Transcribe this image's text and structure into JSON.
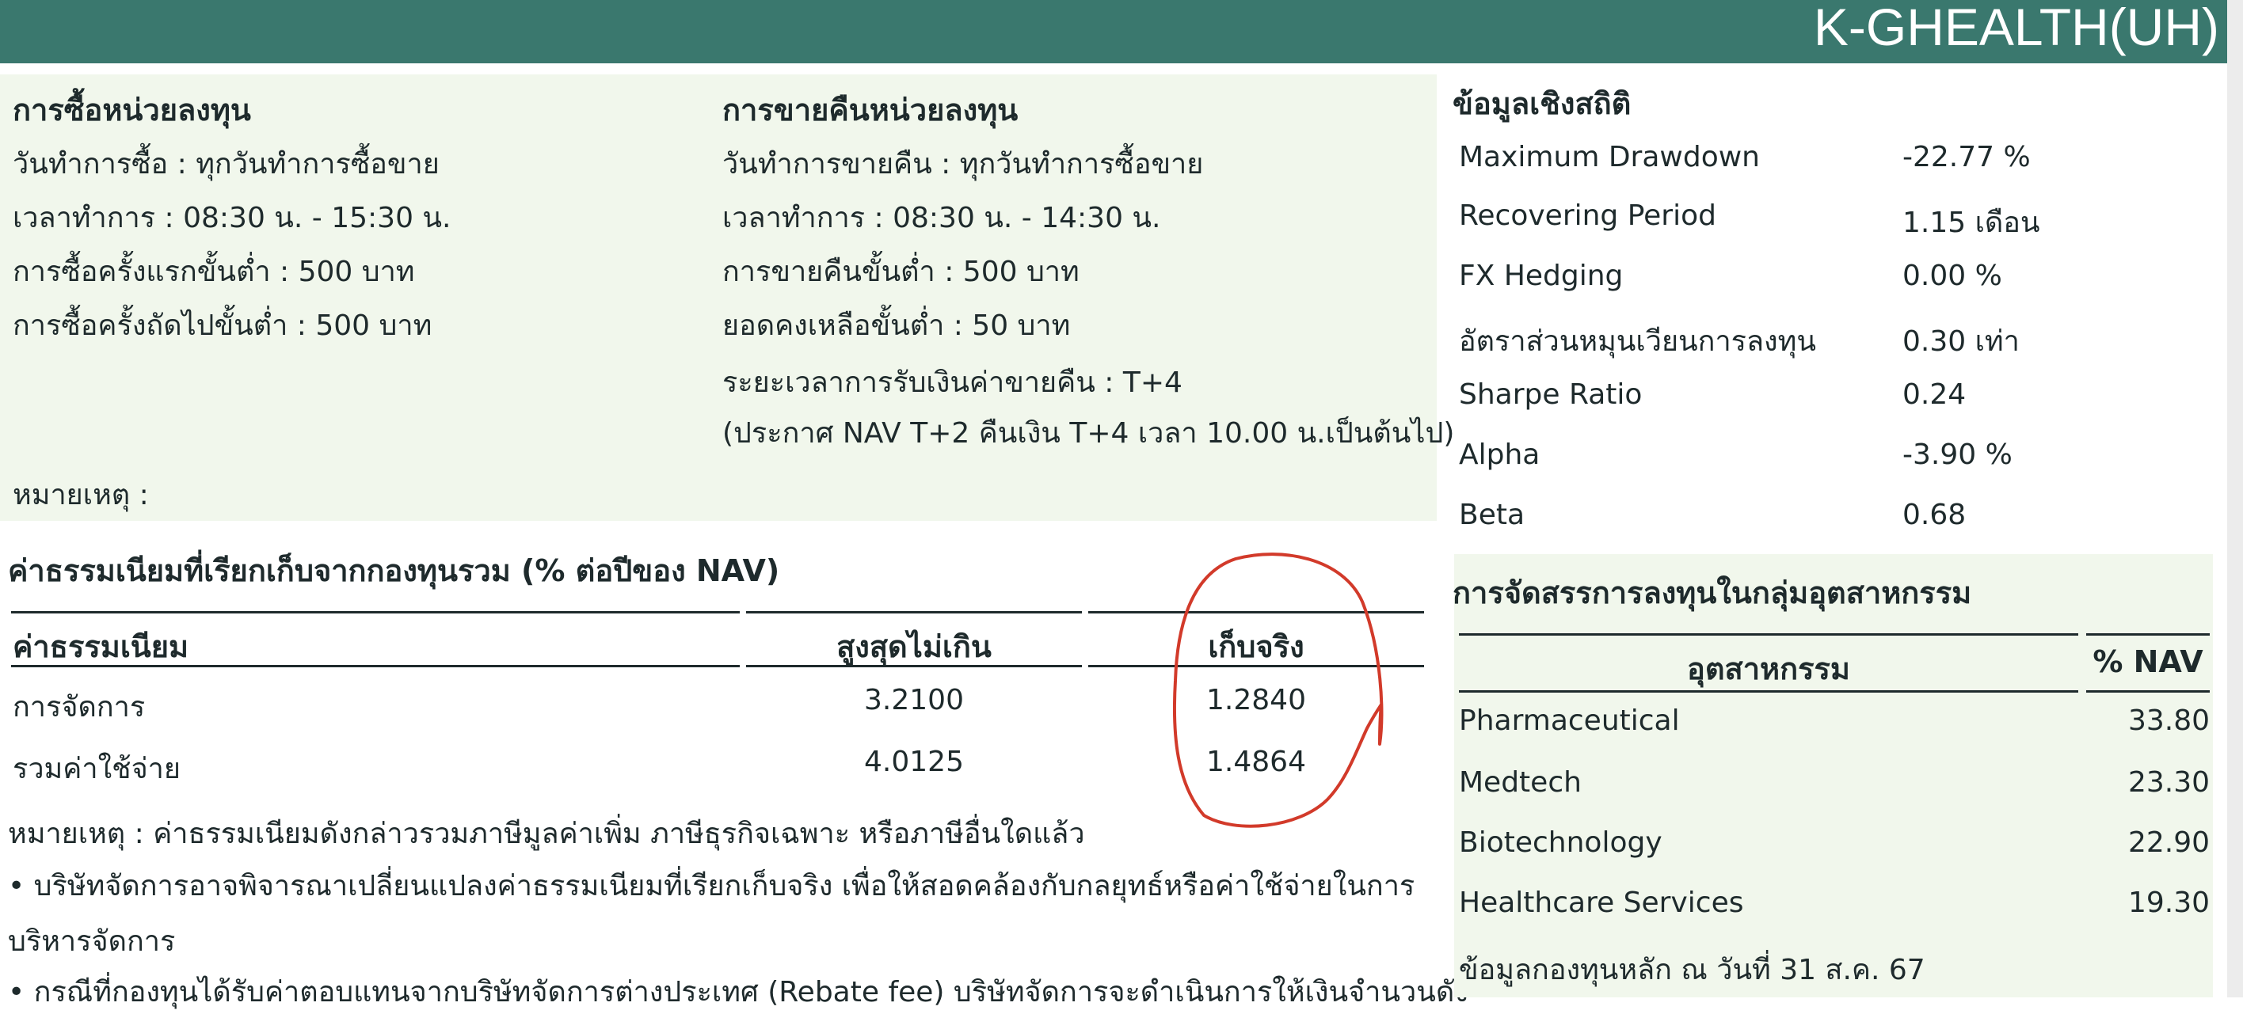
{
  "header": {
    "fund_name": "K-GHEALTH(UH)"
  },
  "purchase": {
    "title": "การซื้อหน่วยลงทุน",
    "lines": [
      "วันทำการซื้อ : ทุกวันทำการซื้อขาย",
      "เวลาทำการ : 08:30 น. - 15:30 น.",
      "การซื้อครั้งแรกขั้นต่ำ : 500 บาท",
      "การซื้อครั้งถัดไปขั้นต่ำ : 500 บาท"
    ]
  },
  "redemption": {
    "title": "การขายคืนหน่วยลงทุน",
    "lines": [
      "วันทำการขายคืน : ทุกวันทำการซื้อขาย",
      "เวลาทำการ : 08:30 น. - 14:30 น.",
      "การขายคืนขั้นต่ำ : 500 บาท",
      "ยอดคงเหลือขั้นต่ำ : 50 บาท",
      "ระยะเวลาการรับเงินค่าขายคืน : T+4",
      "(ประกาศ NAV T+2 คืนเงิน T+4 เวลา 10.00 น.เป็นต้นไป)"
    ]
  },
  "trade_note": "หมายเหตุ :",
  "fees": {
    "title": "ค่าธรรมเนียมที่เรียกเก็บจากกองทุนรวม (% ต่อปีของ NAV)",
    "headers": [
      "ค่าธรรมเนียม",
      "สูงสุดไม่เกิน",
      "เก็บจริง"
    ],
    "rows": [
      {
        "name": "การจัดการ",
        "max": "3.2100",
        "actual": "1.2840"
      },
      {
        "name": "รวมค่าใช้จ่าย",
        "max": "4.0125",
        "actual": "1.4864"
      }
    ],
    "note": "หมายเหตุ : ค่าธรรมเนียมดังกล่าวรวมภาษีมูลค่าเพิ่ม ภาษีธุรกิจเฉพาะ หรือภาษีอื่นใดแล้ว",
    "bullet1": "• บริษัทจัดการอาจพิจารณาเปลี่ยนแปลงค่าธรรมเนียมที่เรียกเก็บจริง เพื่อให้สอดคล้องกับกลยุทธ์หรือค่าใช้จ่ายในการ",
    "bullet1_cont": "บริหารจัดการ",
    "bullet2": "• กรณีที่กองทุนได้รับค่าตอบแทนจากบริษัทจัดการต่างประเทศ (Rebate fee) บริษัทจัดการจะดำเนินการให้เงินจำนวนดัง"
  },
  "stats": {
    "title": "ข้อมูลเชิงสถิติ",
    "rows": [
      {
        "label": "Maximum Drawdown",
        "value": "-22.77 %"
      },
      {
        "label": "Recovering Period",
        "value": "1.15 เดือน"
      },
      {
        "label": "FX Hedging",
        "value": "0.00 %"
      },
      {
        "label": "อัตราส่วนหมุนเวียนการลงทุน",
        "value": "0.30 เท่า"
      },
      {
        "label": "Sharpe Ratio",
        "value": "0.24"
      },
      {
        "label": "Alpha",
        "value": "-3.90 %"
      },
      {
        "label": "Beta",
        "value": "0.68"
      }
    ]
  },
  "industry": {
    "title": "การจัดสรรการลงทุนในกลุ่มอุตสาหกรรม",
    "headers": [
      "อุตสาหกรรม",
      "% NAV"
    ],
    "rows": [
      {
        "name": "Pharmaceutical",
        "pct": "33.80"
      },
      {
        "name": "Medtech",
        "pct": "23.30"
      },
      {
        "name": "Biotechnology",
        "pct": "22.90"
      },
      {
        "name": "Healthcare Services",
        "pct": "19.30"
      }
    ],
    "footer": "ข้อมูลกองทุนหลัก ณ วันที่ 31 ส.ค. 67"
  },
  "colors": {
    "header_bg": "#3a786e",
    "panel_bg": "#f1f7ec",
    "annotation": "#d23a2a"
  }
}
